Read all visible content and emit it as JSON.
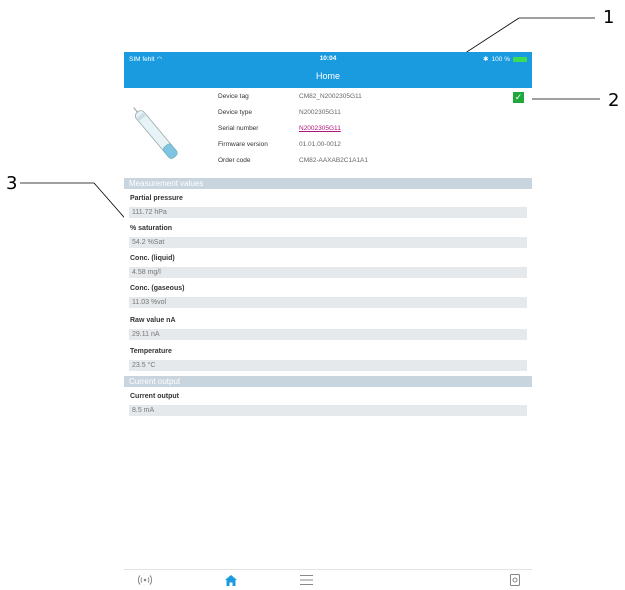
{
  "status_bar": {
    "carrier": "SIM fehlt",
    "time": "10:04",
    "battery": "100 %"
  },
  "nav": {
    "title": "Home"
  },
  "device_info": [
    {
      "label": "Device tag",
      "value": "CM82_N2002305G11"
    },
    {
      "label": "Device type",
      "value": "N2002305G11"
    },
    {
      "label": "Serial number",
      "value": "N2002305G11"
    },
    {
      "label": "Firmware version",
      "value": "01.01.00-0012"
    },
    {
      "label": "Order code",
      "value": "CM82-AAXAB2C1A1A1"
    }
  ],
  "sections": {
    "measurement_title": "Measurement values",
    "current_title": "Current output"
  },
  "measurements": [
    {
      "label": "Partial pressure",
      "value": "111.72 hPa"
    },
    {
      "label": "% saturation",
      "value": "54.2 %Sat"
    },
    {
      "label": "Conc. (liquid)",
      "value": "4.58 mg/l"
    },
    {
      "label": "Conc. (gaseous)",
      "value": "11.03 %vol"
    },
    {
      "label": "Raw value nA",
      "value": "29.11 nA"
    },
    {
      "label": "Temperature",
      "value": "23.5 °C"
    }
  ],
  "current_output": [
    {
      "label": "Current output",
      "value": "8.5 mA"
    }
  ],
  "callouts": {
    "one": "1",
    "two": "2",
    "three": "3"
  },
  "colors": {
    "accent": "#1a9be0",
    "ok": "#1fa83c",
    "link": "#b0157c",
    "section": "#c9d5de"
  },
  "icons": [
    "wifi-icon",
    "bluetooth-icon",
    "battery-icon",
    "device-image",
    "checkmark-icon",
    "signal-icon",
    "home-icon",
    "menu-icon",
    "device-icon"
  ]
}
